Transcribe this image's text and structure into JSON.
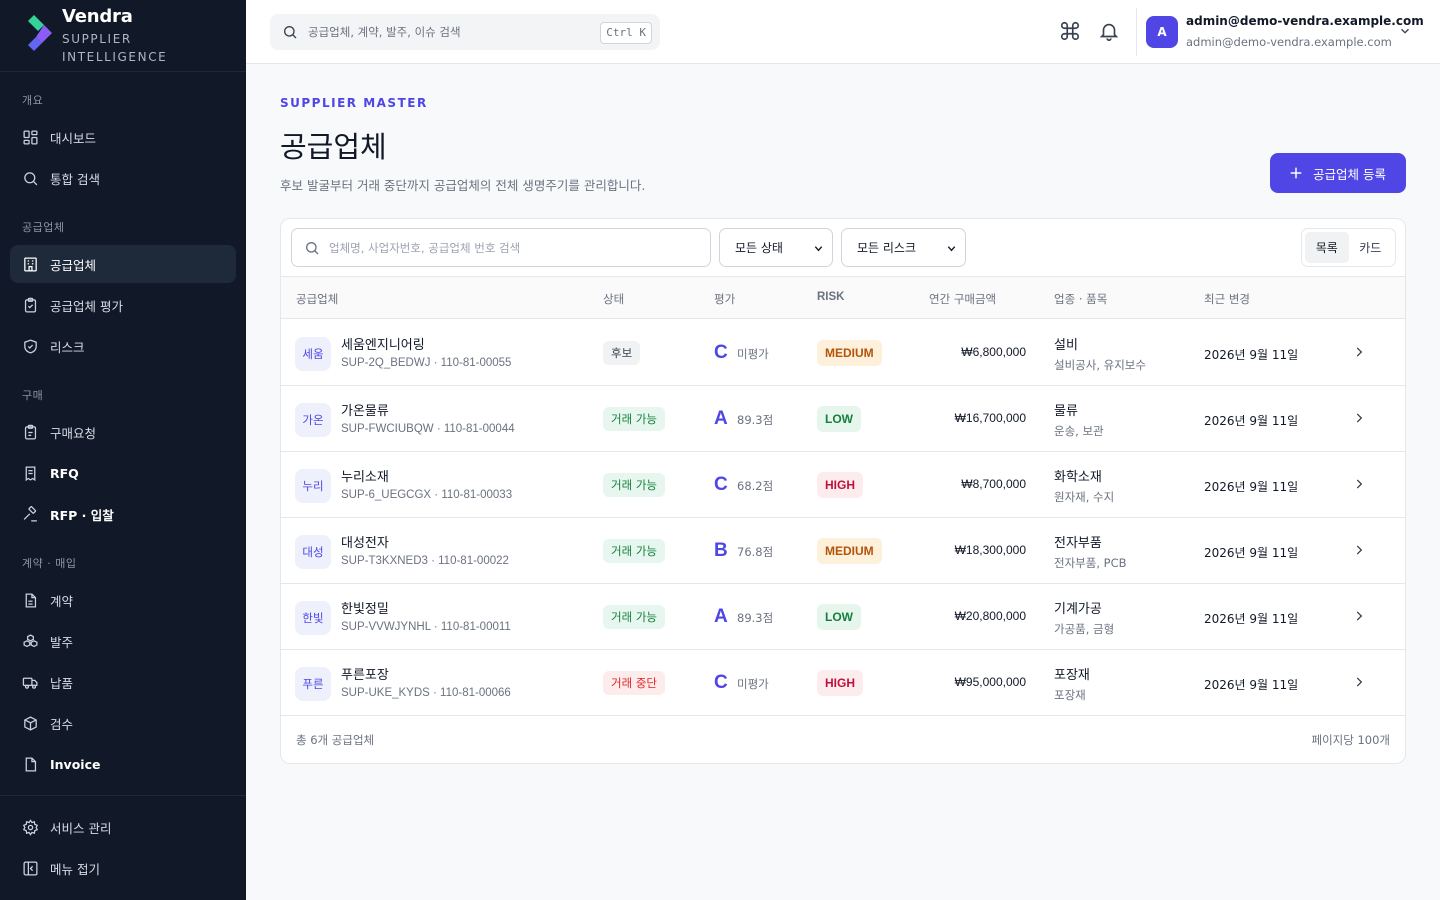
{
  "brand": {
    "name": "Vendra",
    "subtitle": "SUPPLIER INTELLIGENCE"
  },
  "sidebar": {
    "sections": [
      {
        "label": "개요"
      },
      {
        "label": "공급업체"
      },
      {
        "label": "구매"
      },
      {
        "label": "계약 · 매입"
      }
    ],
    "items": [
      {
        "label": "대시보드",
        "icon": "dashboard-icon"
      },
      {
        "label": "통합 검색",
        "icon": "search-icon"
      },
      {
        "label": "공급업체",
        "icon": "building-icon",
        "active": true
      },
      {
        "label": "공급업체 평가",
        "icon": "clipboard-check-icon"
      },
      {
        "label": "리스크",
        "icon": "shield-icon"
      },
      {
        "label": "구매요청",
        "icon": "clipboard-icon"
      },
      {
        "label": "RFQ",
        "icon": "receipt-icon"
      },
      {
        "label": "RFP · 입찰",
        "icon": "gavel-icon"
      },
      {
        "label": "계약",
        "icon": "document-icon"
      },
      {
        "label": "발주",
        "icon": "boxes-icon"
      },
      {
        "label": "납품",
        "icon": "truck-icon"
      },
      {
        "label": "검수",
        "icon": "package-check-icon"
      },
      {
        "label": "Invoice",
        "icon": "invoice-icon"
      }
    ],
    "bottom": [
      {
        "label": "서비스 관리",
        "icon": "gear-icon"
      },
      {
        "label": "메뉴 접기",
        "icon": "collapse-icon"
      }
    ]
  },
  "topbar": {
    "search_placeholder": "공급업체, 계약, 발주, 이슈 검색",
    "shortcut": "Ctrl K",
    "user_initial": "A",
    "user_name": "admin@demo-vendra.example.com",
    "user_email": "admin@demo-vendra.example.com"
  },
  "header": {
    "eyebrow": "SUPPLIER MASTER",
    "title": "공급업체",
    "subtitle": "후보 발굴부터 거래 중단까지 공급업체의 전체 생명주기를 관리합니다.",
    "add_button": "공급업체 등록"
  },
  "filters": {
    "search_placeholder": "업체명, 사업자번호, 공급업체 번호 검색",
    "status_select": "모든 상태",
    "risk_select": "모든 리스크",
    "view_list": "목록",
    "view_card": "카드"
  },
  "table": {
    "columns": [
      "공급업체",
      "상태",
      "평가",
      "RISK",
      "연간 구매금액",
      "업종 · 품목",
      "최근 변경"
    ],
    "rows": [
      {
        "abbr": "세움",
        "name": "세움엔지니어링",
        "code": "SUP-2Q_BEDWJ · 110-81-00055",
        "status": "후보",
        "grade": "C",
        "score": "미평가",
        "risk": "MEDIUM",
        "amount": "₩6,800,000",
        "industry": "설비",
        "items": "설비공사, 유지보수",
        "date": "2026년 9월 11일"
      },
      {
        "abbr": "가온",
        "name": "가온물류",
        "code": "SUP-FWCIUBQW · 110-81-00044",
        "status": "거래 가능",
        "grade": "A",
        "score": "89.3점",
        "risk": "LOW",
        "amount": "₩16,700,000",
        "industry": "물류",
        "items": "운송, 보관",
        "date": "2026년 9월 11일"
      },
      {
        "abbr": "누리",
        "name": "누리소재",
        "code": "SUP-6_UEGCGX · 110-81-00033",
        "status": "거래 가능",
        "grade": "C",
        "score": "68.2점",
        "risk": "HIGH",
        "amount": "₩8,700,000",
        "industry": "화학소재",
        "items": "원자재, 수지",
        "date": "2026년 9월 11일"
      },
      {
        "abbr": "대성",
        "name": "대성전자",
        "code": "SUP-T3KXNED3 · 110-81-00022",
        "status": "거래 가능",
        "grade": "B",
        "score": "76.8점",
        "risk": "MEDIUM",
        "amount": "₩18,300,000",
        "industry": "전자부품",
        "items": "전자부품, PCB",
        "date": "2026년 9월 11일"
      },
      {
        "abbr": "한빛",
        "name": "한빛정밀",
        "code": "SUP-VVWJYNHL · 110-81-00011",
        "status": "거래 가능",
        "grade": "A",
        "score": "89.3점",
        "risk": "LOW",
        "amount": "₩20,800,000",
        "industry": "기계가공",
        "items": "가공품, 금형",
        "date": "2026년 9월 11일"
      },
      {
        "abbr": "푸른",
        "name": "푸른포장",
        "code": "SUP-UKE_KYDS · 110-81-00066",
        "status": "거래 중단",
        "grade": "C",
        "score": "미평가",
        "risk": "HIGH",
        "amount": "₩95,000,000",
        "industry": "포장재",
        "items": "포장재",
        "date": "2026년 9월 11일"
      }
    ],
    "footer_total": "총 6개 공급업체",
    "footer_per_page": "페이지당 100개"
  },
  "colors": {
    "accent": "#4f46e5",
    "sidebar_bg": "#111827",
    "status_candidate": "#f1f2f4",
    "status_ok": "#e7f7ef",
    "status_stopped": "#fdecec",
    "risk_low": "#e6f6ec",
    "risk_medium": "#fdf1dc",
    "risk_high": "#fdecee"
  }
}
